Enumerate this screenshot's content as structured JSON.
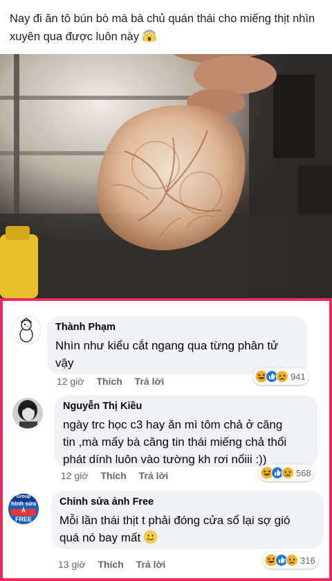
{
  "post": {
    "caption": "Nay đi ăn tô bún bò mà bà chủ quán thái cho miếng thịt nhìn xuyên qua được luôn này",
    "caption_emoji": "scream-emoji"
  },
  "comments": [
    {
      "author": "Thành Phạm",
      "lines": [
        "Nhìn như kiểu cắt ngang qua từng phân tử",
        "vậy"
      ],
      "time": "12 giờ",
      "like_label": "Thích",
      "reply_label": "Trả lời",
      "reactions": [
        "haha",
        "like",
        "sad"
      ],
      "reaction_count": "941"
    },
    {
      "author": "Nguyễn Thị Kiều",
      "lines": [
        "ngày trc học c3 hay ăn mì tôm chả ở căng",
        "tin ,mà mấy bà căng tin thái miếng chả thổi",
        "phát dính luôn vào tường kh rơi nổiii :))"
      ],
      "time": "12 giờ",
      "like_label": "Thích",
      "reply_label": "Trả lời",
      "reactions": [
        "haha",
        "like",
        "sad"
      ],
      "reaction_count": "568"
    },
    {
      "author": "Chỉnh sửa ảnh Free",
      "lines": [
        "Mỗi lần thái thịt t phải đóng cửa sổ lại sợ gió",
        "quá nó bay mất"
      ],
      "time": "13 giờ",
      "like_label": "Thích",
      "reply_label": "Trả lời",
      "reactions": [
        "haha",
        "like",
        "sad"
      ],
      "reaction_count": "316",
      "avatar_text": [
        "Group",
        "hỉnh sửa Ả",
        "FREE"
      ]
    }
  ],
  "colors": {
    "panel_border": "#f2295f",
    "bubble": "#f0f2f5",
    "meta": "#65676b",
    "like_blue": "#1877f2",
    "reaction_yellow": "#f7b125"
  }
}
